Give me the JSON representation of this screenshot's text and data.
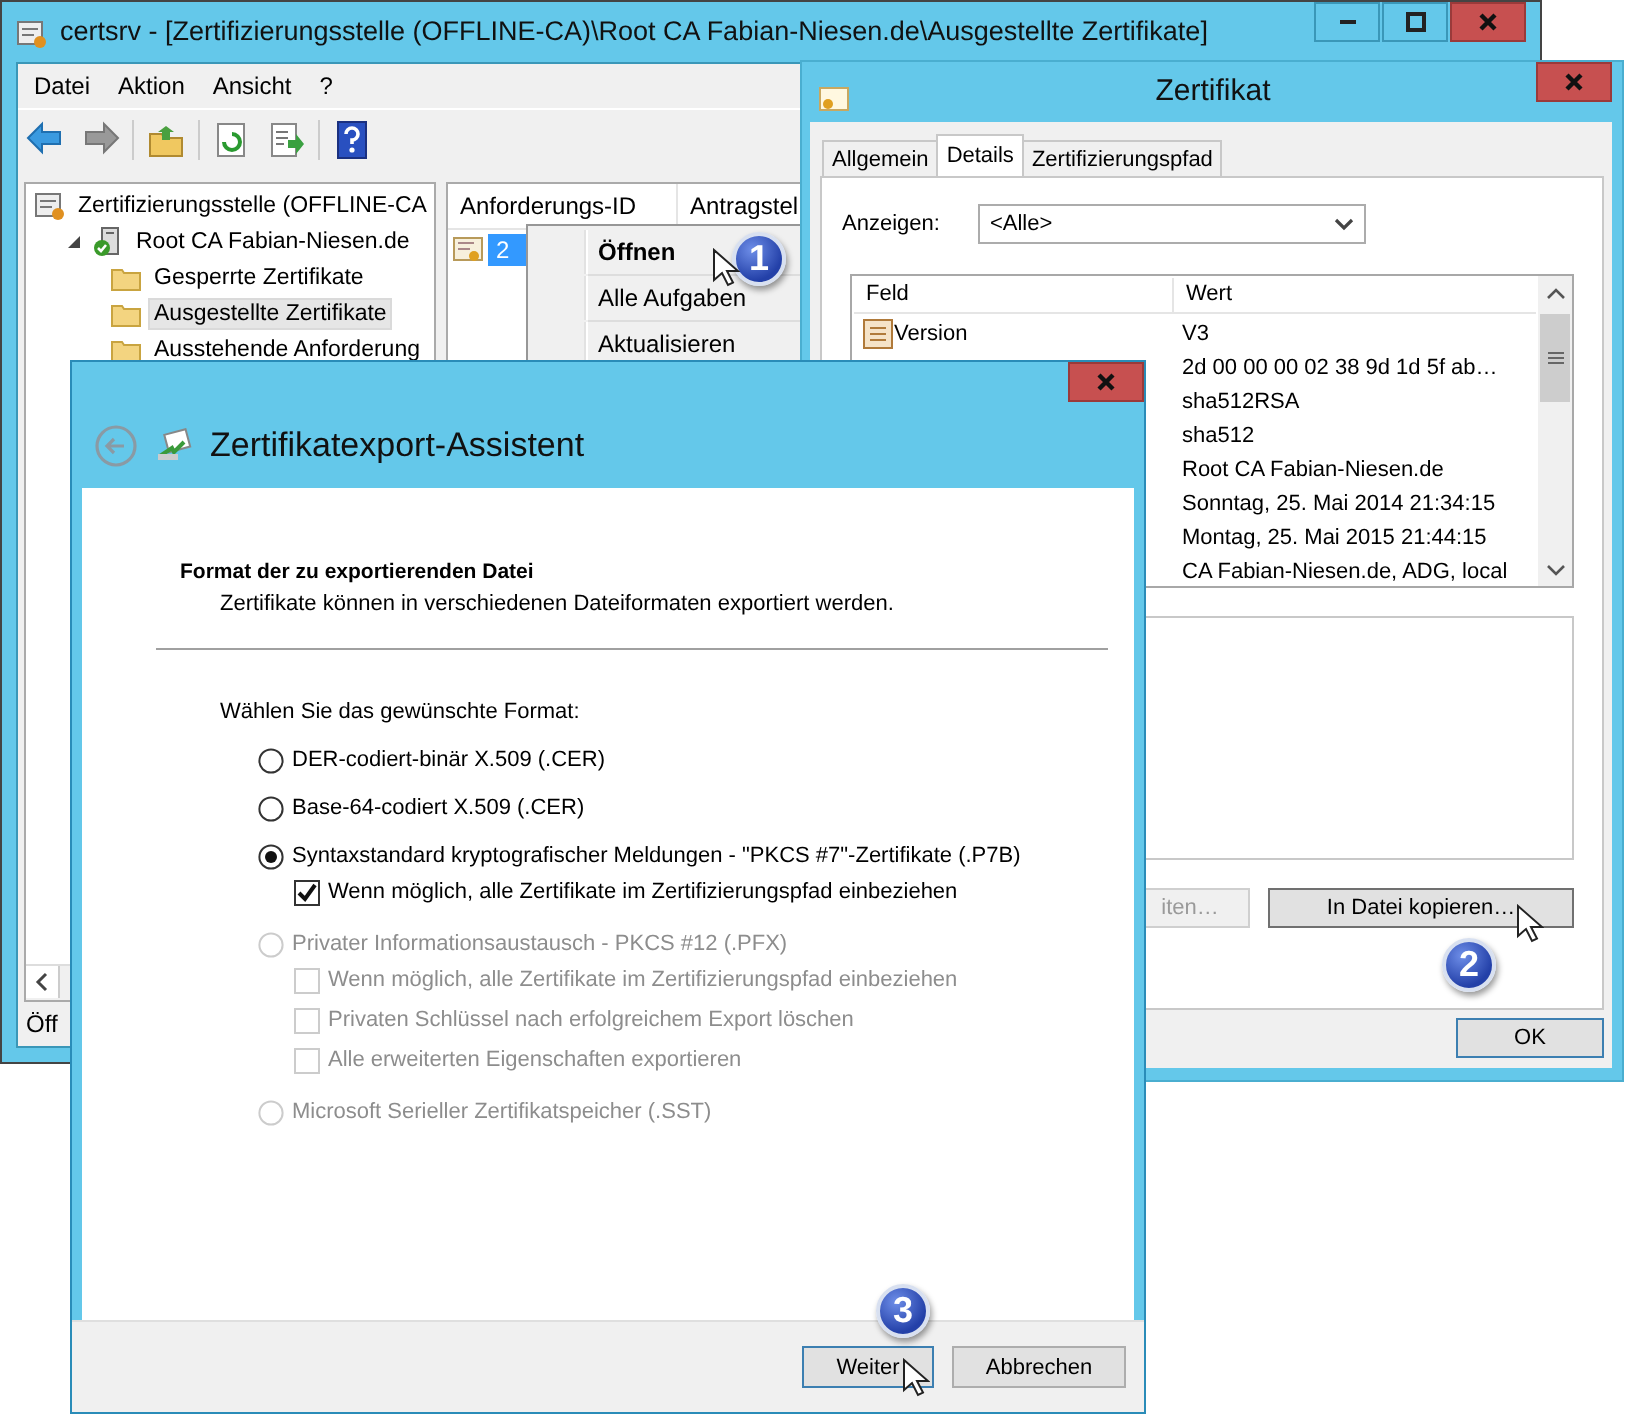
{
  "main_window": {
    "title": "certsrv - [Zertifizierungsstelle (OFFLINE-CA)\\Root CA Fabian-Niesen.de\\Ausgestellte Zertifikate]",
    "menu": [
      "Datei",
      "Aktion",
      "Ansicht",
      "?"
    ],
    "tree": [
      {
        "label": "Zertifizierungsstelle (OFFLINE-CA",
        "selected": false,
        "children": [
          {
            "label": "Root CA Fabian-Niesen.de",
            "selected": false,
            "expanded": true,
            "children": [
              {
                "label": "Gesperrte Zertifikate",
                "selected": false
              },
              {
                "label": "Ausgestellte Zertifikate",
                "selected": true
              },
              {
                "label": "Ausstehende Anforderung",
                "selected": false
              }
            ]
          }
        ]
      }
    ],
    "list": {
      "columns": [
        "Anforderungs-ID",
        "Antragstel"
      ],
      "rows": [
        {
          "id": "2",
          "selected": true
        }
      ]
    },
    "context_menu": [
      {
        "label": "Öffnen",
        "default": true,
        "badge": "1"
      },
      {
        "label": "Alle Aufgaben",
        "default": false
      },
      {
        "label": "Aktualisieren",
        "default": false
      }
    ],
    "status_bar": "Öff"
  },
  "certificate_window": {
    "title": "Zertifikat",
    "tabs": [
      {
        "label": "Allgemein",
        "selected": false
      },
      {
        "label": "Details",
        "selected": true
      },
      {
        "label": "Zertifizierungspfad",
        "selected": false
      }
    ],
    "show_label": "Anzeigen:",
    "show_value": "<Alle>",
    "fields": {
      "columns": [
        "Feld",
        "Wert"
      ],
      "rows": [
        {
          "field": "Version",
          "value": "V3"
        },
        {
          "value": "2d 00 00 00 02 38 9d 1d 5f ab…"
        },
        {
          "value": "sha512RSA"
        },
        {
          "value": "sha512"
        },
        {
          "value": "Root CA Fabian-Niesen.de"
        },
        {
          "value": "Sonntag, 25. Mai 2014 21:34:15"
        },
        {
          "value": "Montag, 25. Mai 2015 21:44:15"
        },
        {
          "value": "CA Fabian-Niesen.de, ADG, local"
        }
      ]
    },
    "buttons": [
      {
        "label": "iten…",
        "disabled": true
      },
      {
        "label": "In Datei kopieren…",
        "disabled": false,
        "badge": "2"
      }
    ],
    "ok": "OK"
  },
  "wizard": {
    "title": "Zertifikatexport-Assistent",
    "heading": "Format der zu exportierenden Datei",
    "subheading": "Zertifikate können in verschiedenen Dateiformaten exportiert werden.",
    "prompt": "Wählen Sie das gewünschte Format:",
    "options": [
      {
        "kind": "radio",
        "label": "DER-codiert-binär X.509 (.CER)",
        "selected": false,
        "disabled": false
      },
      {
        "kind": "radio",
        "label": "Base-64-codiert X.509 (.CER)",
        "selected": false,
        "disabled": false
      },
      {
        "kind": "radio",
        "label": "Syntaxstandard kryptografischer Meldungen - \"PKCS #7\"-Zertifikate (.P7B)",
        "selected": true,
        "disabled": false,
        "children": [
          {
            "kind": "checkbox",
            "label": "Wenn möglich, alle Zertifikate im Zertifizierungspfad einbeziehen",
            "checked": true,
            "disabled": false
          }
        ]
      },
      {
        "kind": "radio",
        "label": "Privater Informationsaustausch - PKCS #12 (.PFX)",
        "selected": false,
        "disabled": true,
        "children": [
          {
            "kind": "checkbox",
            "label": "Wenn möglich, alle Zertifikate im Zertifizierungspfad einbeziehen",
            "checked": false,
            "disabled": true
          },
          {
            "kind": "checkbox",
            "label": "Privaten Schlüssel nach erfolgreichem Export löschen",
            "checked": false,
            "disabled": true
          },
          {
            "kind": "checkbox",
            "label": "Alle erweiterten Eigenschaften exportieren",
            "checked": false,
            "disabled": true
          }
        ]
      },
      {
        "kind": "radio",
        "label": "Microsoft Serieller Zertifikatspeicher (.SST)",
        "selected": false,
        "disabled": true
      }
    ],
    "buttons": [
      {
        "label": "Weiter",
        "default": true,
        "badge": "3"
      },
      {
        "label": "Abbrechen",
        "default": false
      }
    ]
  }
}
